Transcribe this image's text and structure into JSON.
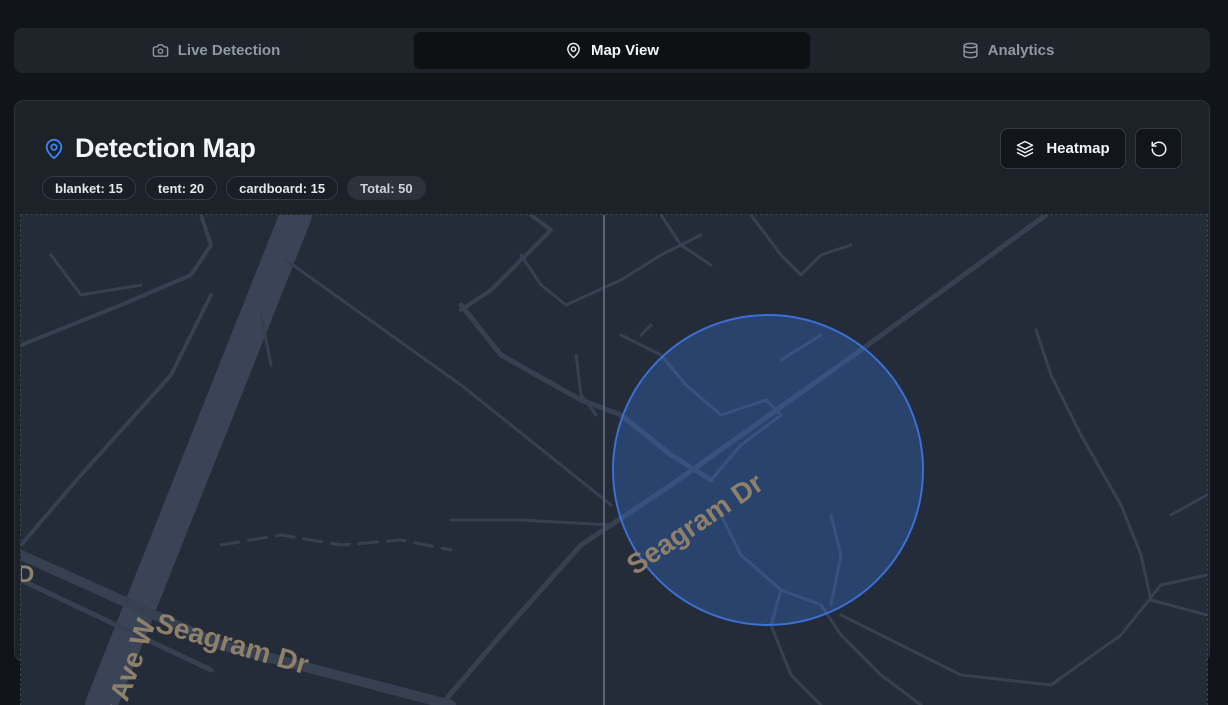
{
  "tabs": [
    {
      "label": "Live Detection",
      "icon": "camera-icon",
      "active": false
    },
    {
      "label": "Map View",
      "icon": "map-pin-icon",
      "active": true
    },
    {
      "label": "Analytics",
      "icon": "database-icon",
      "active": false
    }
  ],
  "card": {
    "title": "Detection Map",
    "title_icon": "map-pin-icon",
    "badges": [
      {
        "label": "blanket: 15"
      },
      {
        "label": "tent: 20"
      },
      {
        "label": "cardboard: 15"
      },
      {
        "label": "Total: 50"
      }
    ],
    "heatmap_button": {
      "label": "Heatmap",
      "icon": "layers-icon"
    },
    "reset_button": {
      "icon": "rotate-ccw-icon"
    }
  },
  "map": {
    "street_labels": [
      {
        "text": "Seagram Dr"
      },
      {
        "text": "Seagram Dr"
      },
      {
        "text": "y Ave W"
      },
      {
        "text": "D"
      }
    ]
  },
  "colors": {
    "accent": "#3b82f6",
    "background": "#111418",
    "card": "#1d2229",
    "map": "#242c3a"
  }
}
